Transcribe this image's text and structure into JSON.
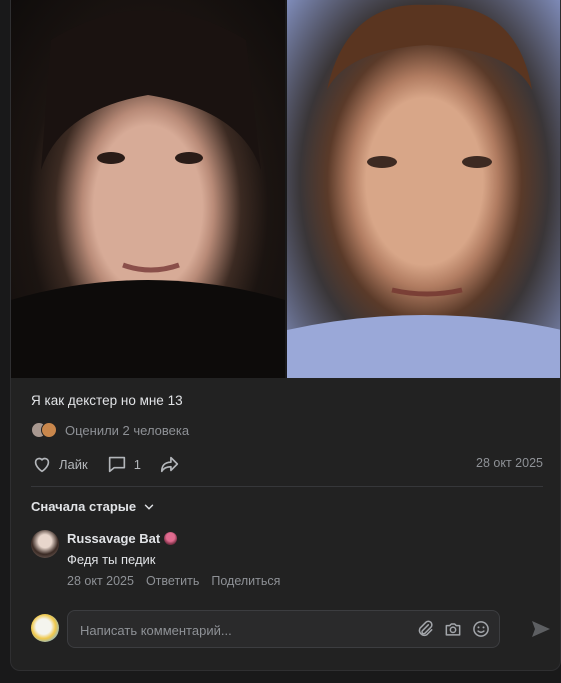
{
  "post": {
    "caption": "Я как декстер но мне 13",
    "likes_summary": "Оценили 2 человека",
    "like_label": "Лайк",
    "comment_count": "1",
    "date": "28 окт 2025"
  },
  "comments": {
    "sort_label": "Сначала старые",
    "items": [
      {
        "author": "Russavage Bat",
        "text": "Федя ты педик",
        "date": "28 окт 2025",
        "reply_label": "Ответить",
        "share_label": "Поделиться"
      }
    ]
  },
  "composer": {
    "placeholder": "Написать комментарий..."
  },
  "icons": {
    "like": "heart-icon",
    "comment": "comment-icon",
    "share": "share-icon",
    "sort": "chevron-down-icon",
    "attach": "paperclip-icon",
    "camera": "camera-icon",
    "emoji": "emoji-icon",
    "send": "send-icon"
  },
  "colors": {
    "background": "#19191a",
    "card": "#222222",
    "text_primary": "#e1e3e6",
    "text_secondary": "#8e9196"
  }
}
